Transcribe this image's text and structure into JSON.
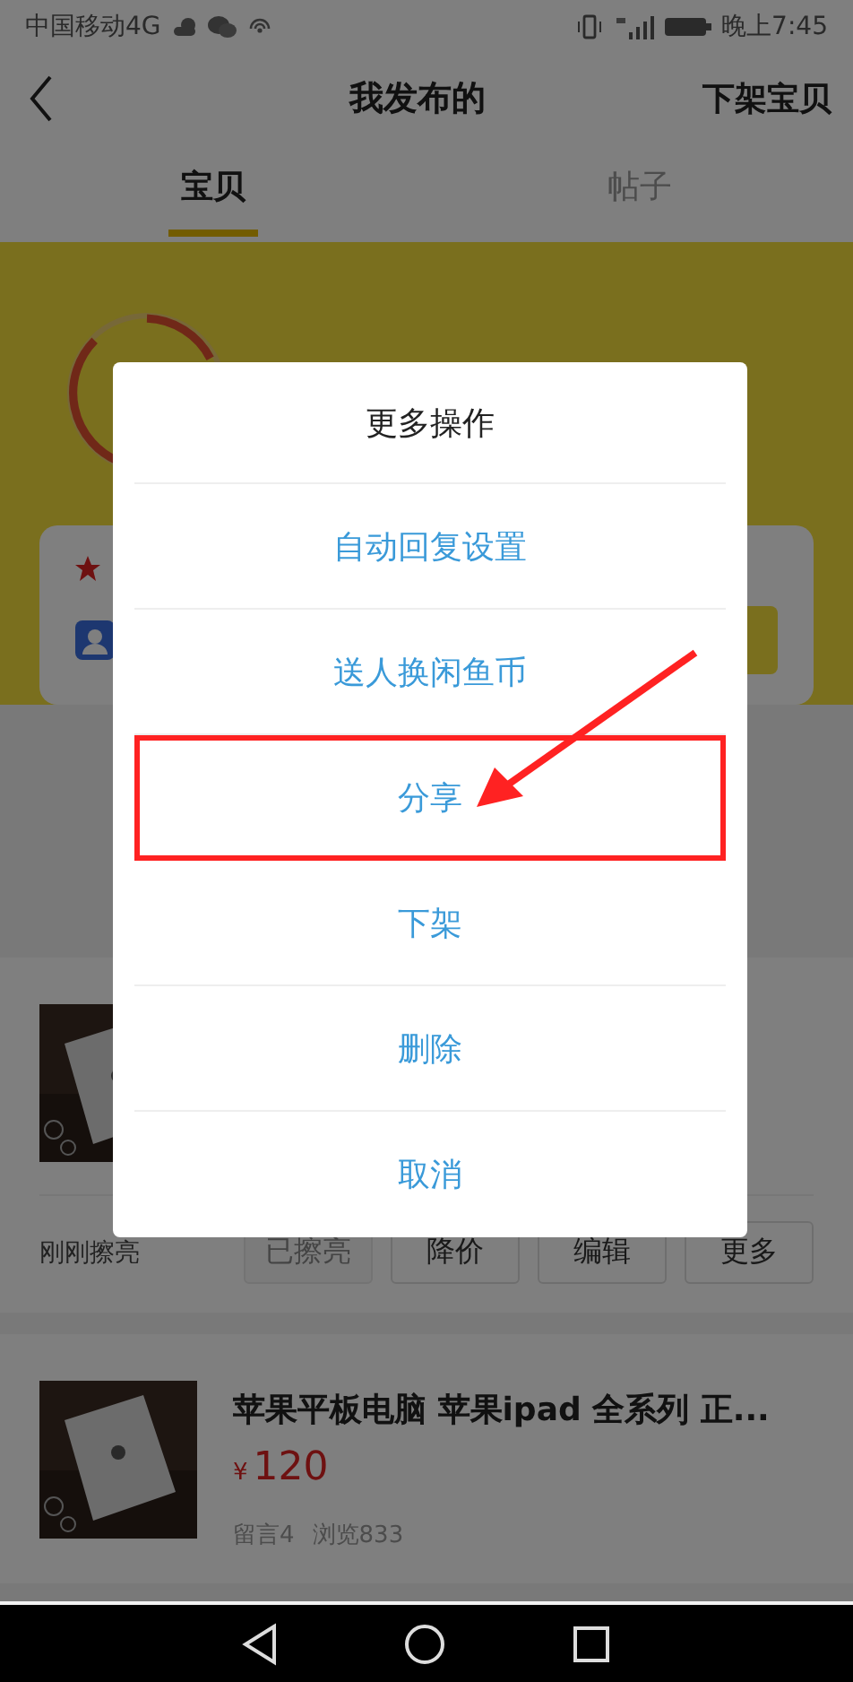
{
  "status_bar": {
    "carrier": "中国移动4G",
    "time": "晚上7:45"
  },
  "header": {
    "title": "我发布的",
    "action": "下架宝贝"
  },
  "tabs": [
    {
      "label": "宝贝",
      "selected": true
    },
    {
      "label": "帖子",
      "selected": false
    }
  ],
  "listings": [
    {
      "refresh_note": "刚刚擦亮",
      "actions": [
        {
          "label": "已擦亮",
          "disabled": true
        },
        {
          "label": "降价",
          "disabled": false
        },
        {
          "label": "编辑",
          "disabled": false
        },
        {
          "label": "更多",
          "disabled": false
        }
      ]
    },
    {
      "title": "苹果平板电脑 苹果ipad 全系列 正...",
      "currency": "¥",
      "price": "120",
      "stats": [
        "留言4",
        "浏览833"
      ]
    }
  ],
  "dialog": {
    "title": "更多操作",
    "actions": [
      {
        "label": "自动回复设置",
        "highlighted": false
      },
      {
        "label": "送人换闲鱼币",
        "highlighted": false
      },
      {
        "label": "分享",
        "highlighted": true
      },
      {
        "label": "下架",
        "highlighted": false
      },
      {
        "label": "删除",
        "highlighted": false
      },
      {
        "label": "取消",
        "highlighted": false
      }
    ]
  }
}
